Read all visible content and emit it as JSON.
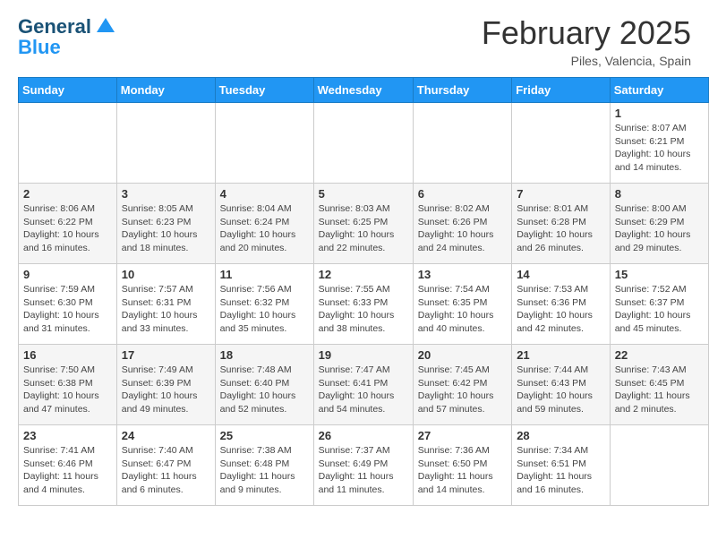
{
  "header": {
    "logo_line1": "General",
    "logo_line2": "Blue",
    "month": "February 2025",
    "location": "Piles, Valencia, Spain"
  },
  "days_of_week": [
    "Sunday",
    "Monday",
    "Tuesday",
    "Wednesday",
    "Thursday",
    "Friday",
    "Saturday"
  ],
  "weeks": [
    {
      "days": [
        {
          "num": "",
          "info": ""
        },
        {
          "num": "",
          "info": ""
        },
        {
          "num": "",
          "info": ""
        },
        {
          "num": "",
          "info": ""
        },
        {
          "num": "",
          "info": ""
        },
        {
          "num": "",
          "info": ""
        },
        {
          "num": "1",
          "info": "Sunrise: 8:07 AM\nSunset: 6:21 PM\nDaylight: 10 hours\nand 14 minutes."
        }
      ]
    },
    {
      "days": [
        {
          "num": "2",
          "info": "Sunrise: 8:06 AM\nSunset: 6:22 PM\nDaylight: 10 hours\nand 16 minutes."
        },
        {
          "num": "3",
          "info": "Sunrise: 8:05 AM\nSunset: 6:23 PM\nDaylight: 10 hours\nand 18 minutes."
        },
        {
          "num": "4",
          "info": "Sunrise: 8:04 AM\nSunset: 6:24 PM\nDaylight: 10 hours\nand 20 minutes."
        },
        {
          "num": "5",
          "info": "Sunrise: 8:03 AM\nSunset: 6:25 PM\nDaylight: 10 hours\nand 22 minutes."
        },
        {
          "num": "6",
          "info": "Sunrise: 8:02 AM\nSunset: 6:26 PM\nDaylight: 10 hours\nand 24 minutes."
        },
        {
          "num": "7",
          "info": "Sunrise: 8:01 AM\nSunset: 6:28 PM\nDaylight: 10 hours\nand 26 minutes."
        },
        {
          "num": "8",
          "info": "Sunrise: 8:00 AM\nSunset: 6:29 PM\nDaylight: 10 hours\nand 29 minutes."
        }
      ]
    },
    {
      "days": [
        {
          "num": "9",
          "info": "Sunrise: 7:59 AM\nSunset: 6:30 PM\nDaylight: 10 hours\nand 31 minutes."
        },
        {
          "num": "10",
          "info": "Sunrise: 7:57 AM\nSunset: 6:31 PM\nDaylight: 10 hours\nand 33 minutes."
        },
        {
          "num": "11",
          "info": "Sunrise: 7:56 AM\nSunset: 6:32 PM\nDaylight: 10 hours\nand 35 minutes."
        },
        {
          "num": "12",
          "info": "Sunrise: 7:55 AM\nSunset: 6:33 PM\nDaylight: 10 hours\nand 38 minutes."
        },
        {
          "num": "13",
          "info": "Sunrise: 7:54 AM\nSunset: 6:35 PM\nDaylight: 10 hours\nand 40 minutes."
        },
        {
          "num": "14",
          "info": "Sunrise: 7:53 AM\nSunset: 6:36 PM\nDaylight: 10 hours\nand 42 minutes."
        },
        {
          "num": "15",
          "info": "Sunrise: 7:52 AM\nSunset: 6:37 PM\nDaylight: 10 hours\nand 45 minutes."
        }
      ]
    },
    {
      "days": [
        {
          "num": "16",
          "info": "Sunrise: 7:50 AM\nSunset: 6:38 PM\nDaylight: 10 hours\nand 47 minutes."
        },
        {
          "num": "17",
          "info": "Sunrise: 7:49 AM\nSunset: 6:39 PM\nDaylight: 10 hours\nand 49 minutes."
        },
        {
          "num": "18",
          "info": "Sunrise: 7:48 AM\nSunset: 6:40 PM\nDaylight: 10 hours\nand 52 minutes."
        },
        {
          "num": "19",
          "info": "Sunrise: 7:47 AM\nSunset: 6:41 PM\nDaylight: 10 hours\nand 54 minutes."
        },
        {
          "num": "20",
          "info": "Sunrise: 7:45 AM\nSunset: 6:42 PM\nDaylight: 10 hours\nand 57 minutes."
        },
        {
          "num": "21",
          "info": "Sunrise: 7:44 AM\nSunset: 6:43 PM\nDaylight: 10 hours\nand 59 minutes."
        },
        {
          "num": "22",
          "info": "Sunrise: 7:43 AM\nSunset: 6:45 PM\nDaylight: 11 hours\nand 2 minutes."
        }
      ]
    },
    {
      "days": [
        {
          "num": "23",
          "info": "Sunrise: 7:41 AM\nSunset: 6:46 PM\nDaylight: 11 hours\nand 4 minutes."
        },
        {
          "num": "24",
          "info": "Sunrise: 7:40 AM\nSunset: 6:47 PM\nDaylight: 11 hours\nand 6 minutes."
        },
        {
          "num": "25",
          "info": "Sunrise: 7:38 AM\nSunset: 6:48 PM\nDaylight: 11 hours\nand 9 minutes."
        },
        {
          "num": "26",
          "info": "Sunrise: 7:37 AM\nSunset: 6:49 PM\nDaylight: 11 hours\nand 11 minutes."
        },
        {
          "num": "27",
          "info": "Sunrise: 7:36 AM\nSunset: 6:50 PM\nDaylight: 11 hours\nand 14 minutes."
        },
        {
          "num": "28",
          "info": "Sunrise: 7:34 AM\nSunset: 6:51 PM\nDaylight: 11 hours\nand 16 minutes."
        },
        {
          "num": "",
          "info": ""
        }
      ]
    }
  ]
}
